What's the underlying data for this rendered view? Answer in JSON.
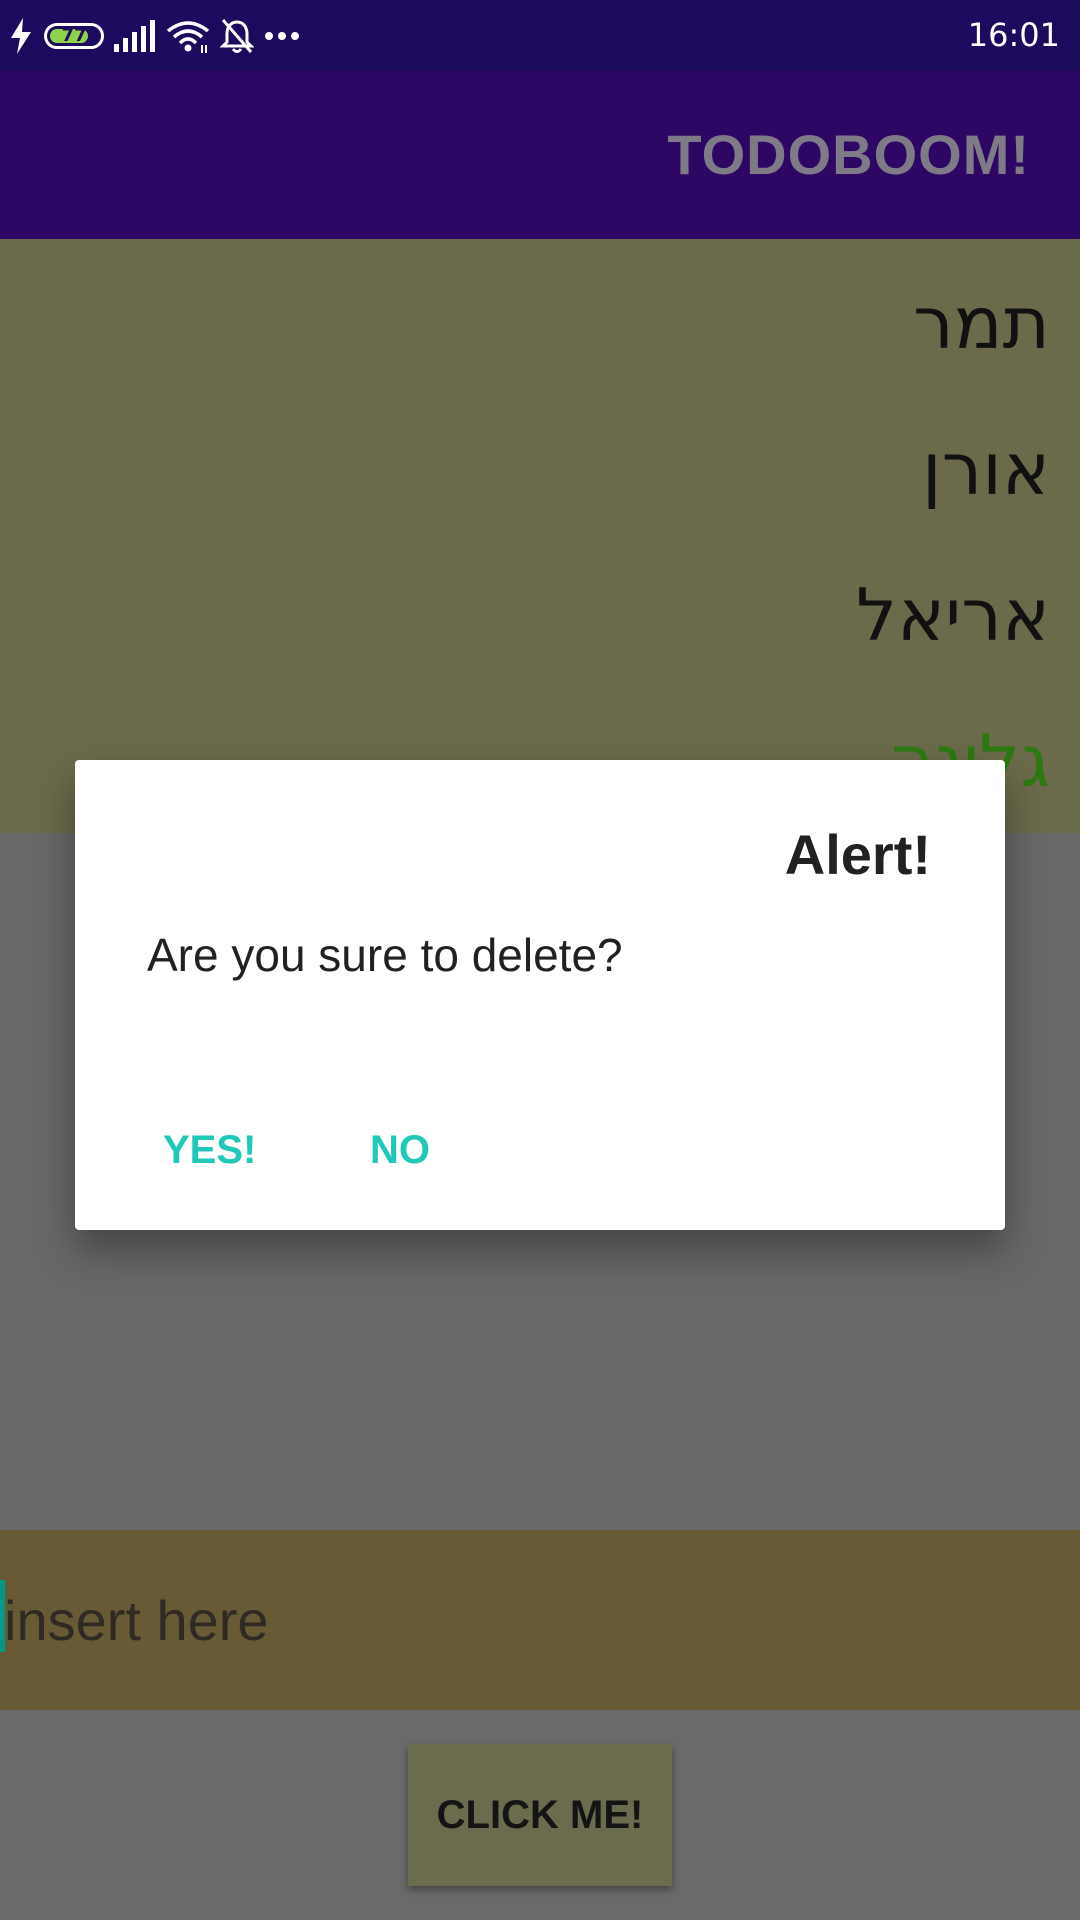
{
  "status_bar": {
    "battery": "77",
    "time": "16:01",
    "icons": [
      "charging-bolt-icon",
      "battery-icon",
      "signal-icon",
      "wifi-icon",
      "notifications-off-icon",
      "more-dots-icon"
    ]
  },
  "app_bar": {
    "title": "TODOBOOM!"
  },
  "list": {
    "items": [
      {
        "text": "תמר",
        "color": "#111111"
      },
      {
        "text": "אורן",
        "color": "#111111"
      },
      {
        "text": "אריאל",
        "color": "#111111"
      },
      {
        "text": "גלינה",
        "color": "#2e7a12"
      }
    ]
  },
  "input": {
    "placeholder": "insert here",
    "value": ""
  },
  "button": {
    "label": "CLICK ME!"
  },
  "dialog": {
    "title": "Alert!",
    "message": "Are you sure to delete?",
    "yes_label": "YES!",
    "no_label": "NO"
  },
  "colors": {
    "status_bar": "#1c0a5e",
    "app_bar": "#2d0763",
    "dialog_button": "#1fc8b8"
  }
}
